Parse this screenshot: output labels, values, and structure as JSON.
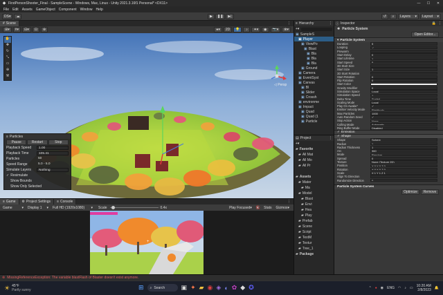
{
  "window": {
    "title": "FirstPersonShooter_Final - SampleScene - Windows, Mac, Linux - Unity 2021.3.16f1 Personal* <DX11>",
    "controls": [
      "—",
      "☐",
      "✕"
    ]
  },
  "menu": [
    "File",
    "Edit",
    "Assets",
    "GameObject",
    "Component",
    "Window",
    "Help"
  ],
  "toolbar": {
    "account_label": "DS",
    "layers_label": "Layers",
    "layout_label": "Layout"
  },
  "scene_tab": "Scene",
  "scene_toolbar": {
    "persp_label": "2D"
  },
  "particles_overlay": {
    "title": "Particles",
    "buttons": [
      "Pause",
      "Restart",
      "Stop"
    ],
    "rows": [
      {
        "label": "Playback Speed",
        "value": "1.00"
      },
      {
        "label": "Playback Time",
        "value": "105.41"
      },
      {
        "label": "Particles",
        "value": "50"
      },
      {
        "label": "Speed Range",
        "value": "5.0 - 5.0"
      },
      {
        "label": "Simulate Layers",
        "value": "Nothing"
      }
    ],
    "checks": [
      {
        "label": "Resimulate",
        "checked": true
      },
      {
        "label": "Show Bounds",
        "checked": false
      },
      {
        "label": "Show Only Selected",
        "checked": false
      }
    ]
  },
  "game_tabs": [
    "Game",
    "Project Settings",
    "Console"
  ],
  "game_toolbar": {
    "mode": "Game",
    "display": "Display 1",
    "resolution": "Full HD (1920x1080)",
    "scale_label": "Scale",
    "scale_value": "0.4x",
    "play_focused": "Play Focused",
    "stats": "Stats",
    "gizmos": "Gizmos"
  },
  "hierarchy": {
    "tab": "Hierarchy",
    "items": [
      {
        "label": "SampleS",
        "indent": 0,
        "selected": false
      },
      {
        "label": "Player",
        "indent": 1,
        "selected": true
      },
      {
        "label": "ViewPo",
        "indent": 2,
        "selected": false
      },
      {
        "label": "Blast",
        "indent": 3,
        "selected": false
      },
      {
        "label": "Bla",
        "indent": 4,
        "selected": false
      },
      {
        "label": "Bla",
        "indent": 4,
        "selected": false
      },
      {
        "label": "Bla",
        "indent": 4,
        "selected": false
      },
      {
        "label": "Ground",
        "indent": 2,
        "selected": false
      },
      {
        "label": "Camera",
        "indent": 1,
        "selected": false
      },
      {
        "label": "EventSyst",
        "indent": 1,
        "selected": false
      },
      {
        "label": "Canvas",
        "indent": 1,
        "selected": false
      },
      {
        "label": "Bl",
        "indent": 2,
        "selected": false
      },
      {
        "label": "Slider",
        "indent": 2,
        "selected": false
      },
      {
        "label": "Crossh",
        "indent": 2,
        "selected": false
      },
      {
        "label": "environme",
        "indent": 1,
        "selected": false
      },
      {
        "label": "Impact",
        "indent": 1,
        "selected": false
      },
      {
        "label": "Quad",
        "indent": 2,
        "selected": false
      },
      {
        "label": "Quad (1",
        "indent": 2,
        "selected": false
      },
      {
        "label": "Particle",
        "indent": 2,
        "selected": false
      }
    ]
  },
  "project": {
    "tab": "Project",
    "items": [
      {
        "label": "Favorite",
        "indent": 0
      },
      {
        "label": "All Mat",
        "indent": 1
      },
      {
        "label": "All Mo",
        "indent": 1
      },
      {
        "label": "All Pr",
        "indent": 1
      },
      {
        "label": "",
        "indent": 0
      },
      {
        "label": "Assets",
        "indent": 0
      },
      {
        "label": "Mater",
        "indent": 1
      },
      {
        "label": "Ma",
        "indent": 2
      },
      {
        "label": "Model",
        "indent": 1
      },
      {
        "label": "Blast",
        "indent": 2
      },
      {
        "label": "Envi",
        "indent": 2
      },
      {
        "label": "Hea",
        "indent": 2
      },
      {
        "label": "Play",
        "indent": 2
      },
      {
        "label": "Prefab",
        "indent": 1
      },
      {
        "label": "Scene",
        "indent": 1
      },
      {
        "label": "Script",
        "indent": 1
      },
      {
        "label": "TextM",
        "indent": 1
      },
      {
        "label": "Textur",
        "indent": 1
      },
      {
        "label": "Tree_1",
        "indent": 1
      },
      {
        "label": "Package",
        "indent": 0
      }
    ]
  },
  "inspector": {
    "tab": "Inspector",
    "object_name": "Particle System",
    "open_editor": "Open Editor...",
    "module_title": "Particle System",
    "props": [
      {
        "label": "Duration",
        "value": "5"
      },
      {
        "label": "Looping",
        "value": "✓"
      },
      {
        "label": "Prewarm",
        "value": ""
      },
      {
        "label": "Start Delay",
        "value": "0"
      },
      {
        "label": "Start Lifetime",
        "value": "1"
      },
      {
        "label": "Start Speed",
        "value": "5"
      },
      {
        "label": "3D Start Size",
        "value": ""
      },
      {
        "label": "Start Size",
        "value": "1"
      },
      {
        "label": "3D Start Rotation",
        "value": ""
      },
      {
        "label": "Start Rotation",
        "value": "0"
      },
      {
        "label": "Flip Rotation",
        "value": "0"
      },
      {
        "label": "Start Color",
        "value": ""
      },
      {
        "label": "Gravity Modifier",
        "value": "0"
      },
      {
        "label": "Simulation Space",
        "value": "Local"
      },
      {
        "label": "Simulation Speed",
        "value": "1"
      },
      {
        "label": "Delta Time",
        "value": "Scaled"
      },
      {
        "label": "Scaling Mode",
        "value": "Local"
      },
      {
        "label": "Play On Awake*",
        "value": "✓"
      },
      {
        "label": "Emitter Velocity Mode",
        "value": "Rigidbody"
      },
      {
        "label": "Max Particles",
        "value": "1000"
      },
      {
        "label": "Auto Random Seed",
        "value": "✓"
      },
      {
        "label": "Stop Action",
        "value": "None"
      },
      {
        "label": "Culling Mode",
        "value": "Automatic"
      },
      {
        "label": "Ring Buffer Mode",
        "value": "Disabled"
      }
    ],
    "modules": [
      "Emission",
      "Shape"
    ],
    "shape_props": [
      {
        "label": "Shape",
        "value": "Sphere"
      },
      {
        "label": "Radius",
        "value": "1"
      },
      {
        "label": "Radius Thickness",
        "value": "1"
      },
      {
        "label": "Arc",
        "value": "360"
      },
      {
        "label": "Mode",
        "value": "Random"
      },
      {
        "label": "Spread",
        "value": "0"
      },
      {
        "label": "Texture",
        "value": "None (Texture 2D)"
      },
      {
        "label": "Position",
        "value": "X 0     Y 0     Z 0"
      },
      {
        "label": "Rotation",
        "value": "X 0     Y 0     Z 0"
      },
      {
        "label": "Scale",
        "value": "X 1     Y 1     Z 1"
      },
      {
        "label": "Align To Direction",
        "value": ""
      },
      {
        "label": "Randomize Direction",
        "value": "0"
      }
    ],
    "curves_title": "Particle System Curves",
    "optimize": "Optimize",
    "remove": "Remove"
  },
  "console": {
    "message": "MissingReferenceException: The variable blastFlash of Blaster doesn't exist anymore."
  },
  "taskbar": {
    "weather_temp": "45°F",
    "weather_desc": "Partly sunny",
    "search": "Search",
    "lang": "ENG",
    "time": "10:20 AM",
    "date": "2/8/2023"
  }
}
